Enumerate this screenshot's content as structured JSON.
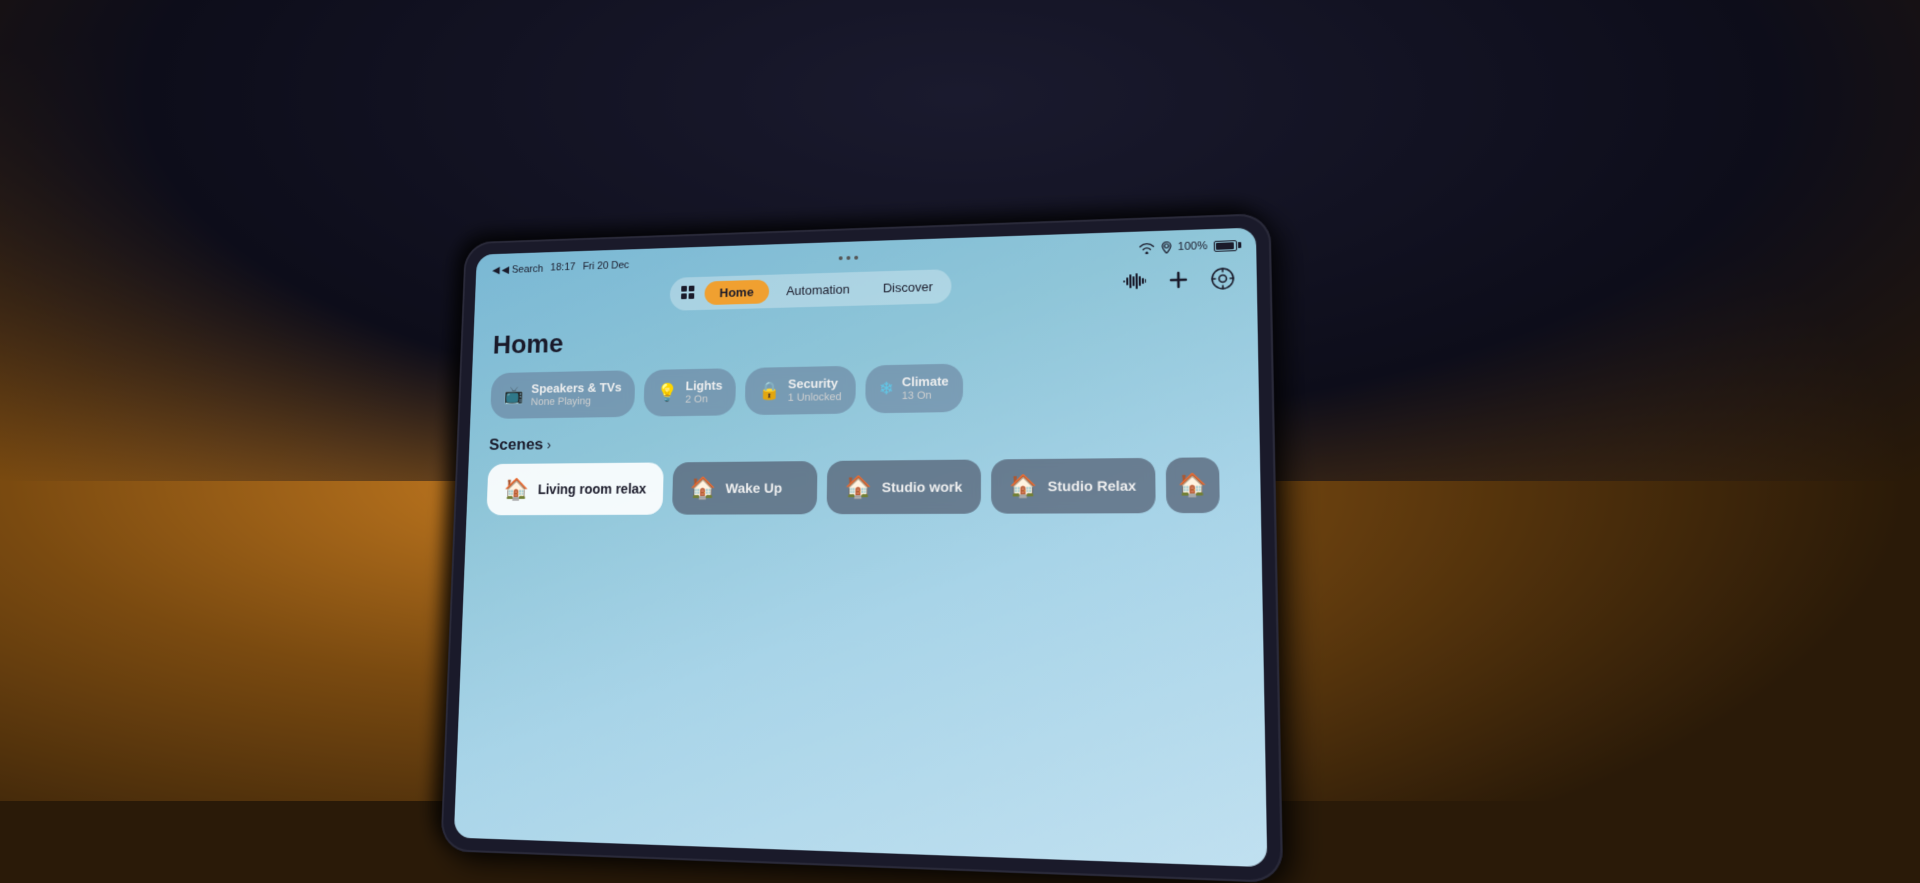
{
  "background": {
    "color": "#2a1a08"
  },
  "statusBar": {
    "back_label": "◀ Search",
    "time": "18:17",
    "date": "Fri 20 Dec",
    "wifi_icon": "wifi",
    "battery_percent": "100%",
    "dots": [
      "•",
      "•",
      "•"
    ]
  },
  "navTabs": {
    "grid_icon": "⊞",
    "tabs": [
      {
        "id": "home",
        "label": "Home",
        "active": true
      },
      {
        "id": "automation",
        "label": "Automation",
        "active": false
      },
      {
        "id": "discover",
        "label": "Discover",
        "active": false
      }
    ],
    "right_icons": [
      {
        "id": "waveform",
        "icon": "waveform",
        "symbol": "𝅘𝅥𝅮"
      },
      {
        "id": "add",
        "icon": "add",
        "symbol": "+"
      },
      {
        "id": "settings",
        "icon": "settings",
        "symbol": "⚙"
      }
    ]
  },
  "pageTitle": "Home",
  "summaryCards": [
    {
      "id": "speakers",
      "icon": "📺",
      "label": "Speakers & TVs",
      "sub": "None Playing"
    },
    {
      "id": "lights",
      "icon": "💡",
      "label": "Lights",
      "sub": "2 On"
    },
    {
      "id": "security",
      "icon": "🔒",
      "label": "Security",
      "sub": "1 Unlocked"
    },
    {
      "id": "climate",
      "icon": "❄",
      "label": "Climate",
      "sub": "13 On"
    }
  ],
  "scenesSection": {
    "title": "Scenes",
    "chevron": "›",
    "scenes": [
      {
        "id": "living-room-relax",
        "icon": "🏠",
        "label": "Living room relax",
        "style": "white"
      },
      {
        "id": "wake-up",
        "icon": "🏠",
        "label": "Wake Up",
        "style": "dark"
      },
      {
        "id": "studio-work",
        "icon": "🏠",
        "label": "Studio work",
        "style": "dark"
      },
      {
        "id": "studio-relax",
        "icon": "🏠",
        "label": "Studio Relax",
        "style": "dark"
      }
    ]
  }
}
